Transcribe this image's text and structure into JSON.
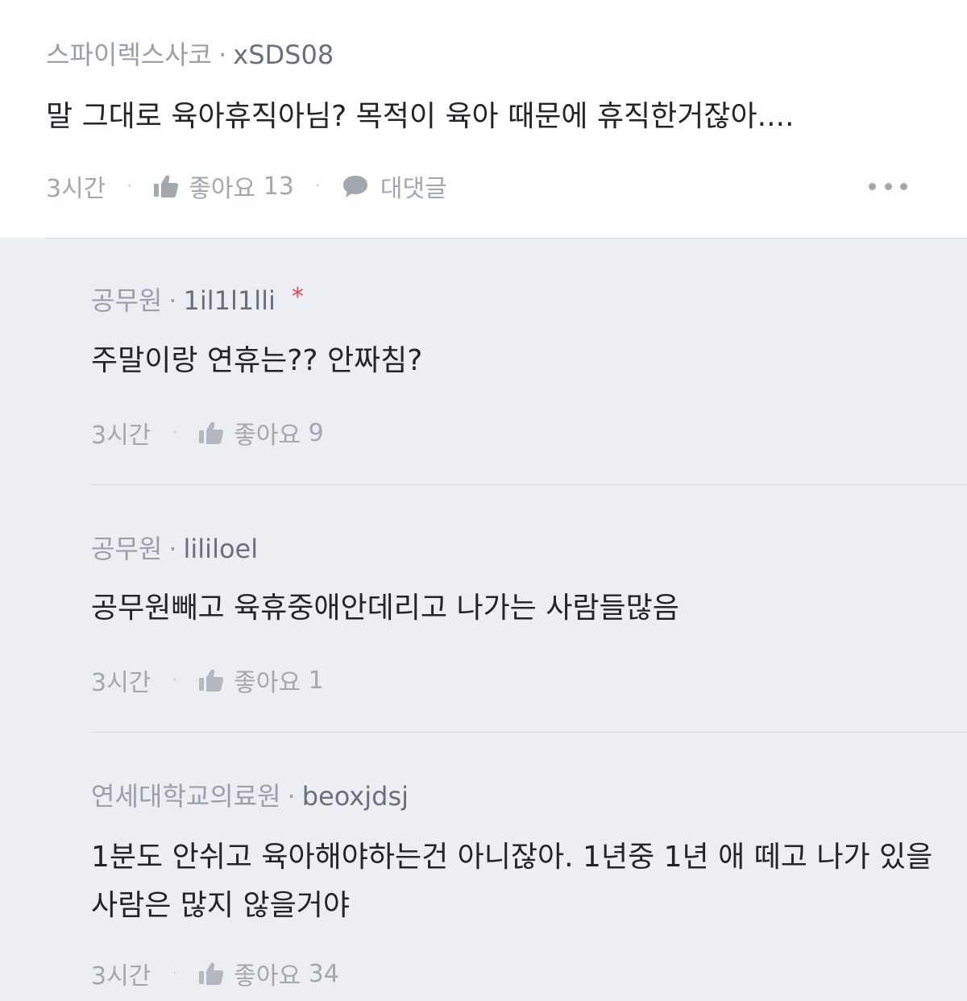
{
  "main_comment": {
    "company": "스파이렉스사코",
    "separator": "·",
    "nickname": "xSDS08",
    "text": "말 그대로 육아휴직아님? 목적이 육아 때문에 휴직한거잖아....",
    "time": "3시간",
    "like_label": "좋아요",
    "like_count": "13",
    "reply_label": "대댓글",
    "meta_dot": "·"
  },
  "replies": [
    {
      "company": "공무원",
      "separator": "·",
      "nickname": "1il1l1lli",
      "author_mark": "*",
      "text": "주말이랑 연휴는?? 안짜침?",
      "time": "3시간",
      "like_label": "좋아요",
      "like_count": "9",
      "meta_dot": "·"
    },
    {
      "company": "공무원",
      "separator": "·",
      "nickname": "lililoel",
      "text": "공무원빼고 육휴중애안데리고 나가는 사람들많음",
      "time": "3시간",
      "like_label": "좋아요",
      "like_count": "1",
      "meta_dot": "·"
    },
    {
      "company": "연세대학교의료원",
      "separator": "·",
      "nickname": "beoxjdsj",
      "text": "1분도 안쉬고 육아해야하는건 아니잖아. 1년중 1년 애 떼고 나가 있을 사람은 많지 않을거야",
      "time": "3시간",
      "like_label": "좋아요",
      "like_count": "34",
      "meta_dot": "·"
    }
  ],
  "colors": {
    "reply_background": "#edeef3",
    "muted_text": "#a3a7ae",
    "body_text": "#222428",
    "author_mark": "#e5484d"
  },
  "icons": {
    "like": "thumbs-up-icon",
    "reply": "speech-bubble-icon",
    "more": "more-horizontal-icon"
  }
}
